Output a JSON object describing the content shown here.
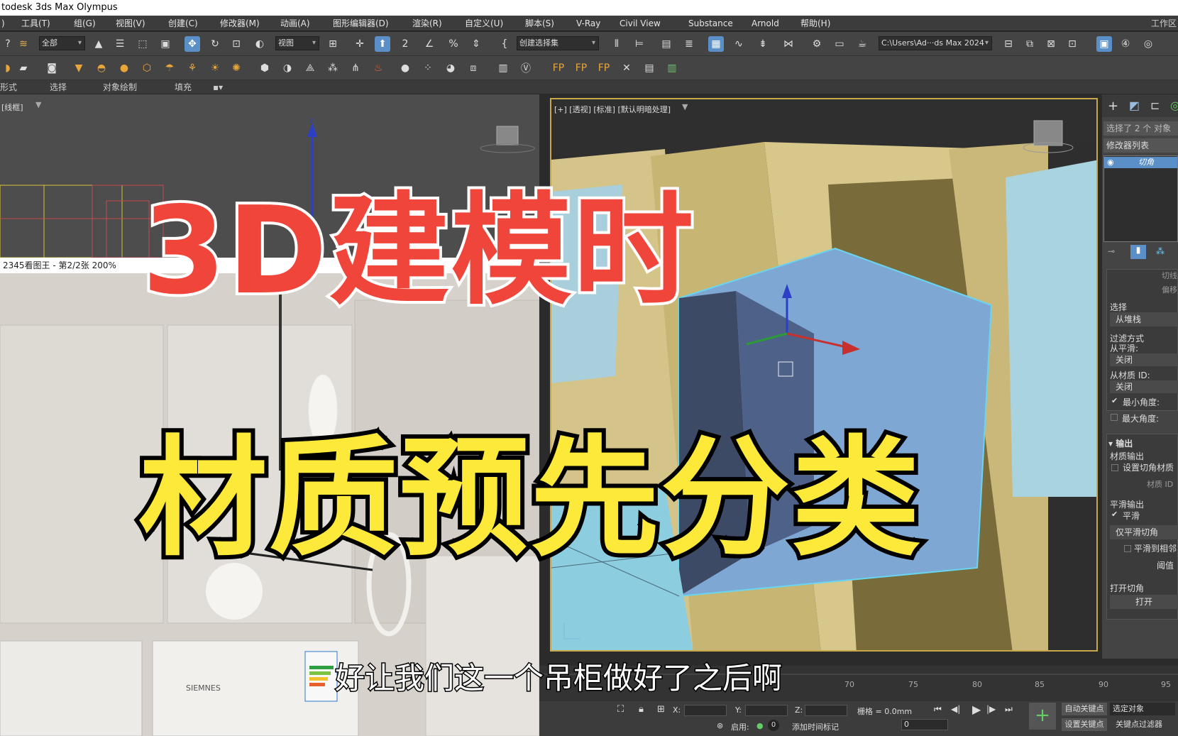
{
  "window": {
    "title": "todesk 3ds Max Olympus"
  },
  "menu": {
    "items": [
      "工具(T)",
      "组(G)",
      "视图(V)",
      "创建(C)",
      "修改器(M)",
      "动画(A)",
      "图形编辑器(D)",
      "渲染(R)",
      "自定义(U)",
      "脚本(S)",
      "V-Ray",
      "Civil View",
      "Substance",
      "Arnold",
      "帮助(H)"
    ],
    "right_label": "工作区"
  },
  "toolbar": {
    "filter_select": "全部",
    "view_select": "视图",
    "selection_set": "创建选择集",
    "project_path": "C:\\Users\\Ad···ds Max 2024"
  },
  "ribbon": {
    "tabs": [
      "形式",
      "选择",
      "对象绘制",
      "填充"
    ]
  },
  "viewport_left": {
    "label": "[线框]"
  },
  "viewport_right": {
    "label": "[+] [透视] [标准] [默认明暗处理]"
  },
  "image_viewer": {
    "caption": "2345看图王 - 第2/2张 200%",
    "fridge_brand": "SIEMNES"
  },
  "command_panel": {
    "selected_count": "选择了 2 个 对象",
    "modifier_list": "修改器列表",
    "modifier_name": "切角",
    "partial_label_1": "切线",
    "partial_label_2": "偏移",
    "select_label": "选择",
    "from_stack": "从堆栈",
    "filter_label": "过滤方式",
    "from_smooth": "从平滑:",
    "off1": "关闭",
    "from_mat_id": "从材质 ID:",
    "off2": "关闭",
    "min_angle": "最小角度:",
    "max_angle": "最大角度:",
    "output": "输出",
    "mat_output": "材质输出",
    "set_chamfer_mat": "设置切角材质",
    "mat_id": "材质 ID",
    "smooth_output": "平滑输出",
    "smooth": "平滑",
    "smooth_chamfer_only": "仅平滑切角",
    "smooth_adjacent": "平滑到相邻",
    "threshold": "阈值",
    "open_chamfer": "打开切角",
    "open": "打开"
  },
  "status": {
    "x_label": "X:",
    "y_label": "Y:",
    "z_label": "Z:",
    "grid": "栅格 = 0.0mm",
    "enable": "启用:",
    "add_time_tag": "添加时间标记",
    "auto_key": "自动关键点",
    "set_key": "设置关键点",
    "selected_object": "选定对象",
    "key_filter": "关键点过滤器",
    "frame": "0",
    "timeline_ticks": [
      "70",
      "75",
      "80",
      "85",
      "90",
      "95"
    ]
  },
  "overlay": {
    "title_red": "3D建模时",
    "title_yellow": "材质预先分类",
    "subtitle": "好让我们这一个吊柜做好了之后啊"
  }
}
